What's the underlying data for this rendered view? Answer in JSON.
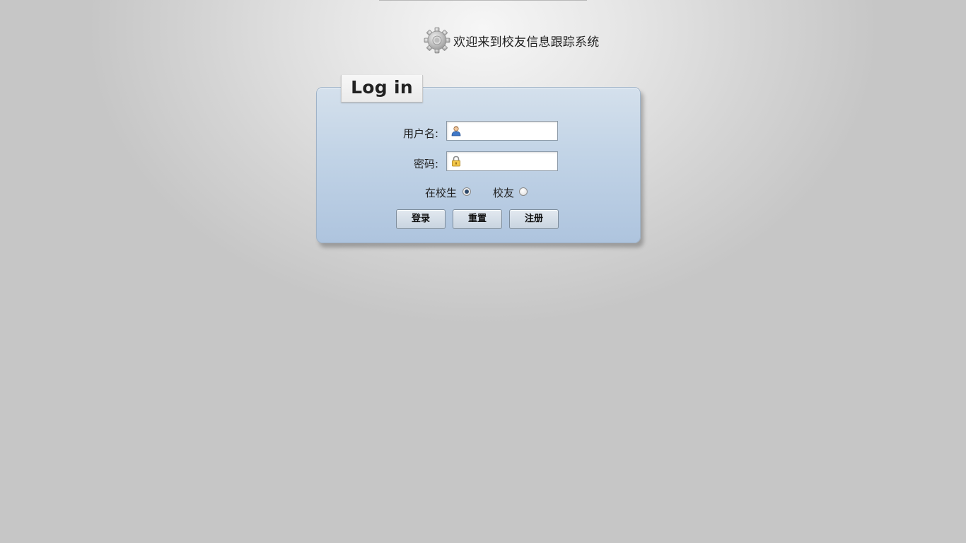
{
  "header": {
    "welcome_text": "欢迎来到校友信息跟踪系统",
    "icon": "gear-icon"
  },
  "login": {
    "tab_title": "Log in",
    "username_label": "用户名:",
    "username_value": "",
    "username_icon": "user-icon",
    "password_label": "密码:",
    "password_value": "",
    "password_icon": "lock-icon",
    "role_options": [
      {
        "label": "在校生",
        "checked": true
      },
      {
        "label": "校友",
        "checked": false
      }
    ],
    "buttons": {
      "login": "登录",
      "reset": "重置",
      "register": "注册"
    }
  },
  "colors": {
    "panel_top": "#d4e0ec",
    "panel_bottom": "#aec4de",
    "background": "#c5c5c5"
  }
}
